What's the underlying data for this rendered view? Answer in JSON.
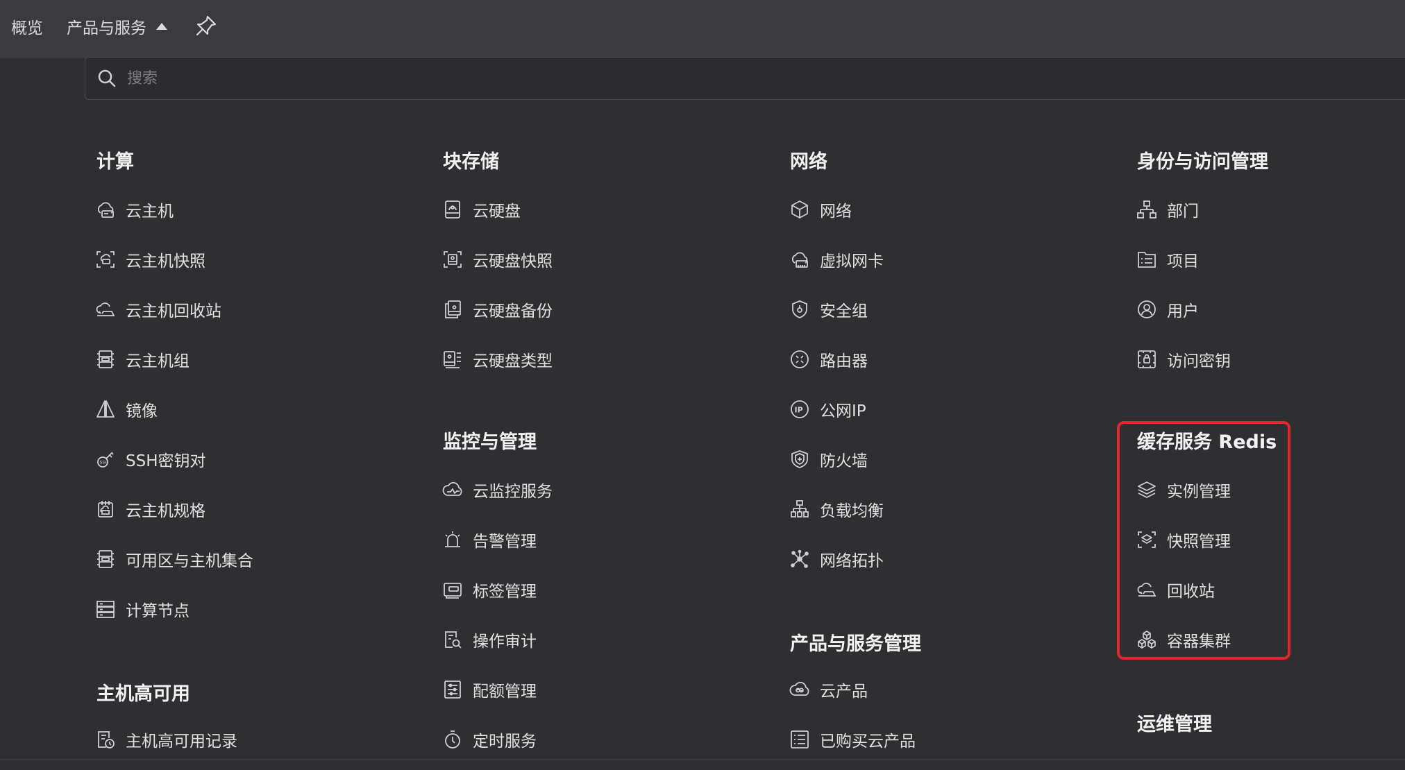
{
  "topbar": {
    "overview": "概览",
    "products": "产品与服务"
  },
  "search": {
    "placeholder": "搜索"
  },
  "columns": [
    {
      "sections": [
        {
          "title": "计算",
          "items": [
            {
              "label": "云主机",
              "icon": "cloud-host-icon"
            },
            {
              "label": "云主机快照",
              "icon": "snapshot-icon"
            },
            {
              "label": "云主机回收站",
              "icon": "recycle-icon"
            },
            {
              "label": "云主机组",
              "icon": "server-group-icon"
            },
            {
              "label": "镜像",
              "icon": "image-icon"
            },
            {
              "label": "SSH密钥对",
              "icon": "key-icon"
            },
            {
              "label": "云主机规格",
              "icon": "spec-icon"
            },
            {
              "label": "可用区与主机集合",
              "icon": "zone-icon"
            },
            {
              "label": "计算节点",
              "icon": "node-icon"
            }
          ]
        },
        {
          "title": "主机高可用",
          "items": [
            {
              "label": "主机高可用记录",
              "icon": "ha-record-icon"
            }
          ]
        }
      ]
    },
    {
      "sections": [
        {
          "title": "块存储",
          "items": [
            {
              "label": "云硬盘",
              "icon": "disk-icon"
            },
            {
              "label": "云硬盘快照",
              "icon": "disk-snapshot-icon"
            },
            {
              "label": "云硬盘备份",
              "icon": "disk-backup-icon"
            },
            {
              "label": "云硬盘类型",
              "icon": "disk-type-icon"
            }
          ]
        },
        {
          "title": "监控与管理",
          "items": [
            {
              "label": "云监控服务",
              "icon": "monitor-icon"
            },
            {
              "label": "告警管理",
              "icon": "alarm-icon"
            },
            {
              "label": "标签管理",
              "icon": "tag-icon"
            },
            {
              "label": "操作审计",
              "icon": "audit-icon"
            },
            {
              "label": "配额管理",
              "icon": "quota-icon"
            },
            {
              "label": "定时服务",
              "icon": "timer-icon"
            }
          ]
        }
      ]
    },
    {
      "sections": [
        {
          "title": "网络",
          "items": [
            {
              "label": "网络",
              "icon": "network-icon"
            },
            {
              "label": "虚拟网卡",
              "icon": "nic-icon"
            },
            {
              "label": "安全组",
              "icon": "security-group-icon"
            },
            {
              "label": "路由器",
              "icon": "router-icon"
            },
            {
              "label": "公网IP",
              "icon": "ip-icon"
            },
            {
              "label": "防火墙",
              "icon": "firewall-icon"
            },
            {
              "label": "负载均衡",
              "icon": "load-balancer-icon"
            },
            {
              "label": "网络拓扑",
              "icon": "topology-icon"
            }
          ]
        },
        {
          "title": "产品与服务管理",
          "items": [
            {
              "label": "云产品",
              "icon": "cloud-product-icon"
            },
            {
              "label": "已购买云产品",
              "icon": "purchased-list-icon"
            }
          ]
        }
      ]
    },
    {
      "sections": [
        {
          "title": "身份与访问管理",
          "items": [
            {
              "label": "部门",
              "icon": "department-icon"
            },
            {
              "label": "项目",
              "icon": "project-icon"
            },
            {
              "label": "用户",
              "icon": "user-icon"
            },
            {
              "label": "访问密钥",
              "icon": "access-key-icon"
            }
          ]
        },
        {
          "title": "缓存服务 Redis",
          "items": [
            {
              "label": "实例管理",
              "icon": "layers-icon"
            },
            {
              "label": "快照管理",
              "icon": "redis-snapshot-icon"
            },
            {
              "label": "回收站",
              "icon": "recycle-icon"
            },
            {
              "label": "容器集群",
              "icon": "cubes-icon"
            }
          ]
        },
        {
          "title": "运维管理",
          "items": []
        }
      ]
    }
  ]
}
